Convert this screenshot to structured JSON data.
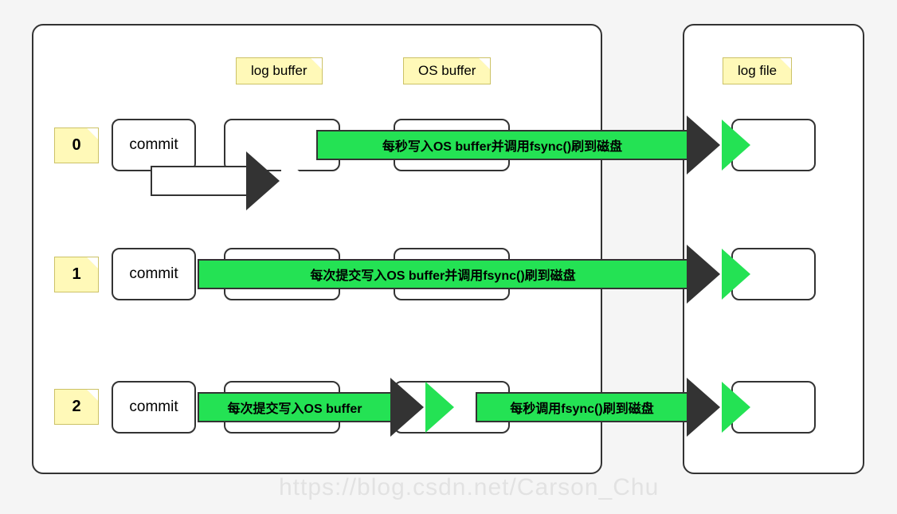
{
  "headers": {
    "log_buffer": "log buffer",
    "os_buffer": "OS buffer",
    "log_file": "log file"
  },
  "modes": [
    {
      "id": "0",
      "commit": "commit"
    },
    {
      "id": "1",
      "commit": "commit"
    },
    {
      "id": "2",
      "commit": "commit"
    }
  ],
  "arrows": {
    "mode0_write": "",
    "mode0_fsync": "每秒写入OS buffer并调用fsync()刷到磁盘",
    "mode1": "每次提交写入OS buffer并调用fsync()刷到磁盘",
    "mode2_write": "每次提交写入OS buffer",
    "mode2_fsync": "每秒调用fsync()刷到磁盘"
  },
  "watermark": "https://blog.csdn.net/Carson_Chu",
  "chart_data": {
    "type": "diagram",
    "title": "innodb_flush_log_at_trx_commit modes",
    "columns": [
      "commit",
      "log buffer",
      "OS buffer",
      "log file"
    ],
    "rows": [
      {
        "mode": 0,
        "flows": [
          {
            "from": "commit",
            "to": "log buffer",
            "label": "",
            "color": "white"
          },
          {
            "from": "log buffer",
            "to": "log file",
            "label": "每秒写入OS buffer并调用fsync()刷到磁盘",
            "color": "green"
          }
        ]
      },
      {
        "mode": 1,
        "flows": [
          {
            "from": "commit",
            "to": "log file",
            "label": "每次提交写入OS buffer并调用fsync()刷到磁盘",
            "color": "green"
          }
        ]
      },
      {
        "mode": 2,
        "flows": [
          {
            "from": "commit",
            "to": "OS buffer",
            "label": "每次提交写入OS buffer",
            "color": "green"
          },
          {
            "from": "OS buffer",
            "to": "log file",
            "label": "每秒调用fsync()刷到磁盘",
            "color": "green"
          }
        ]
      }
    ]
  }
}
